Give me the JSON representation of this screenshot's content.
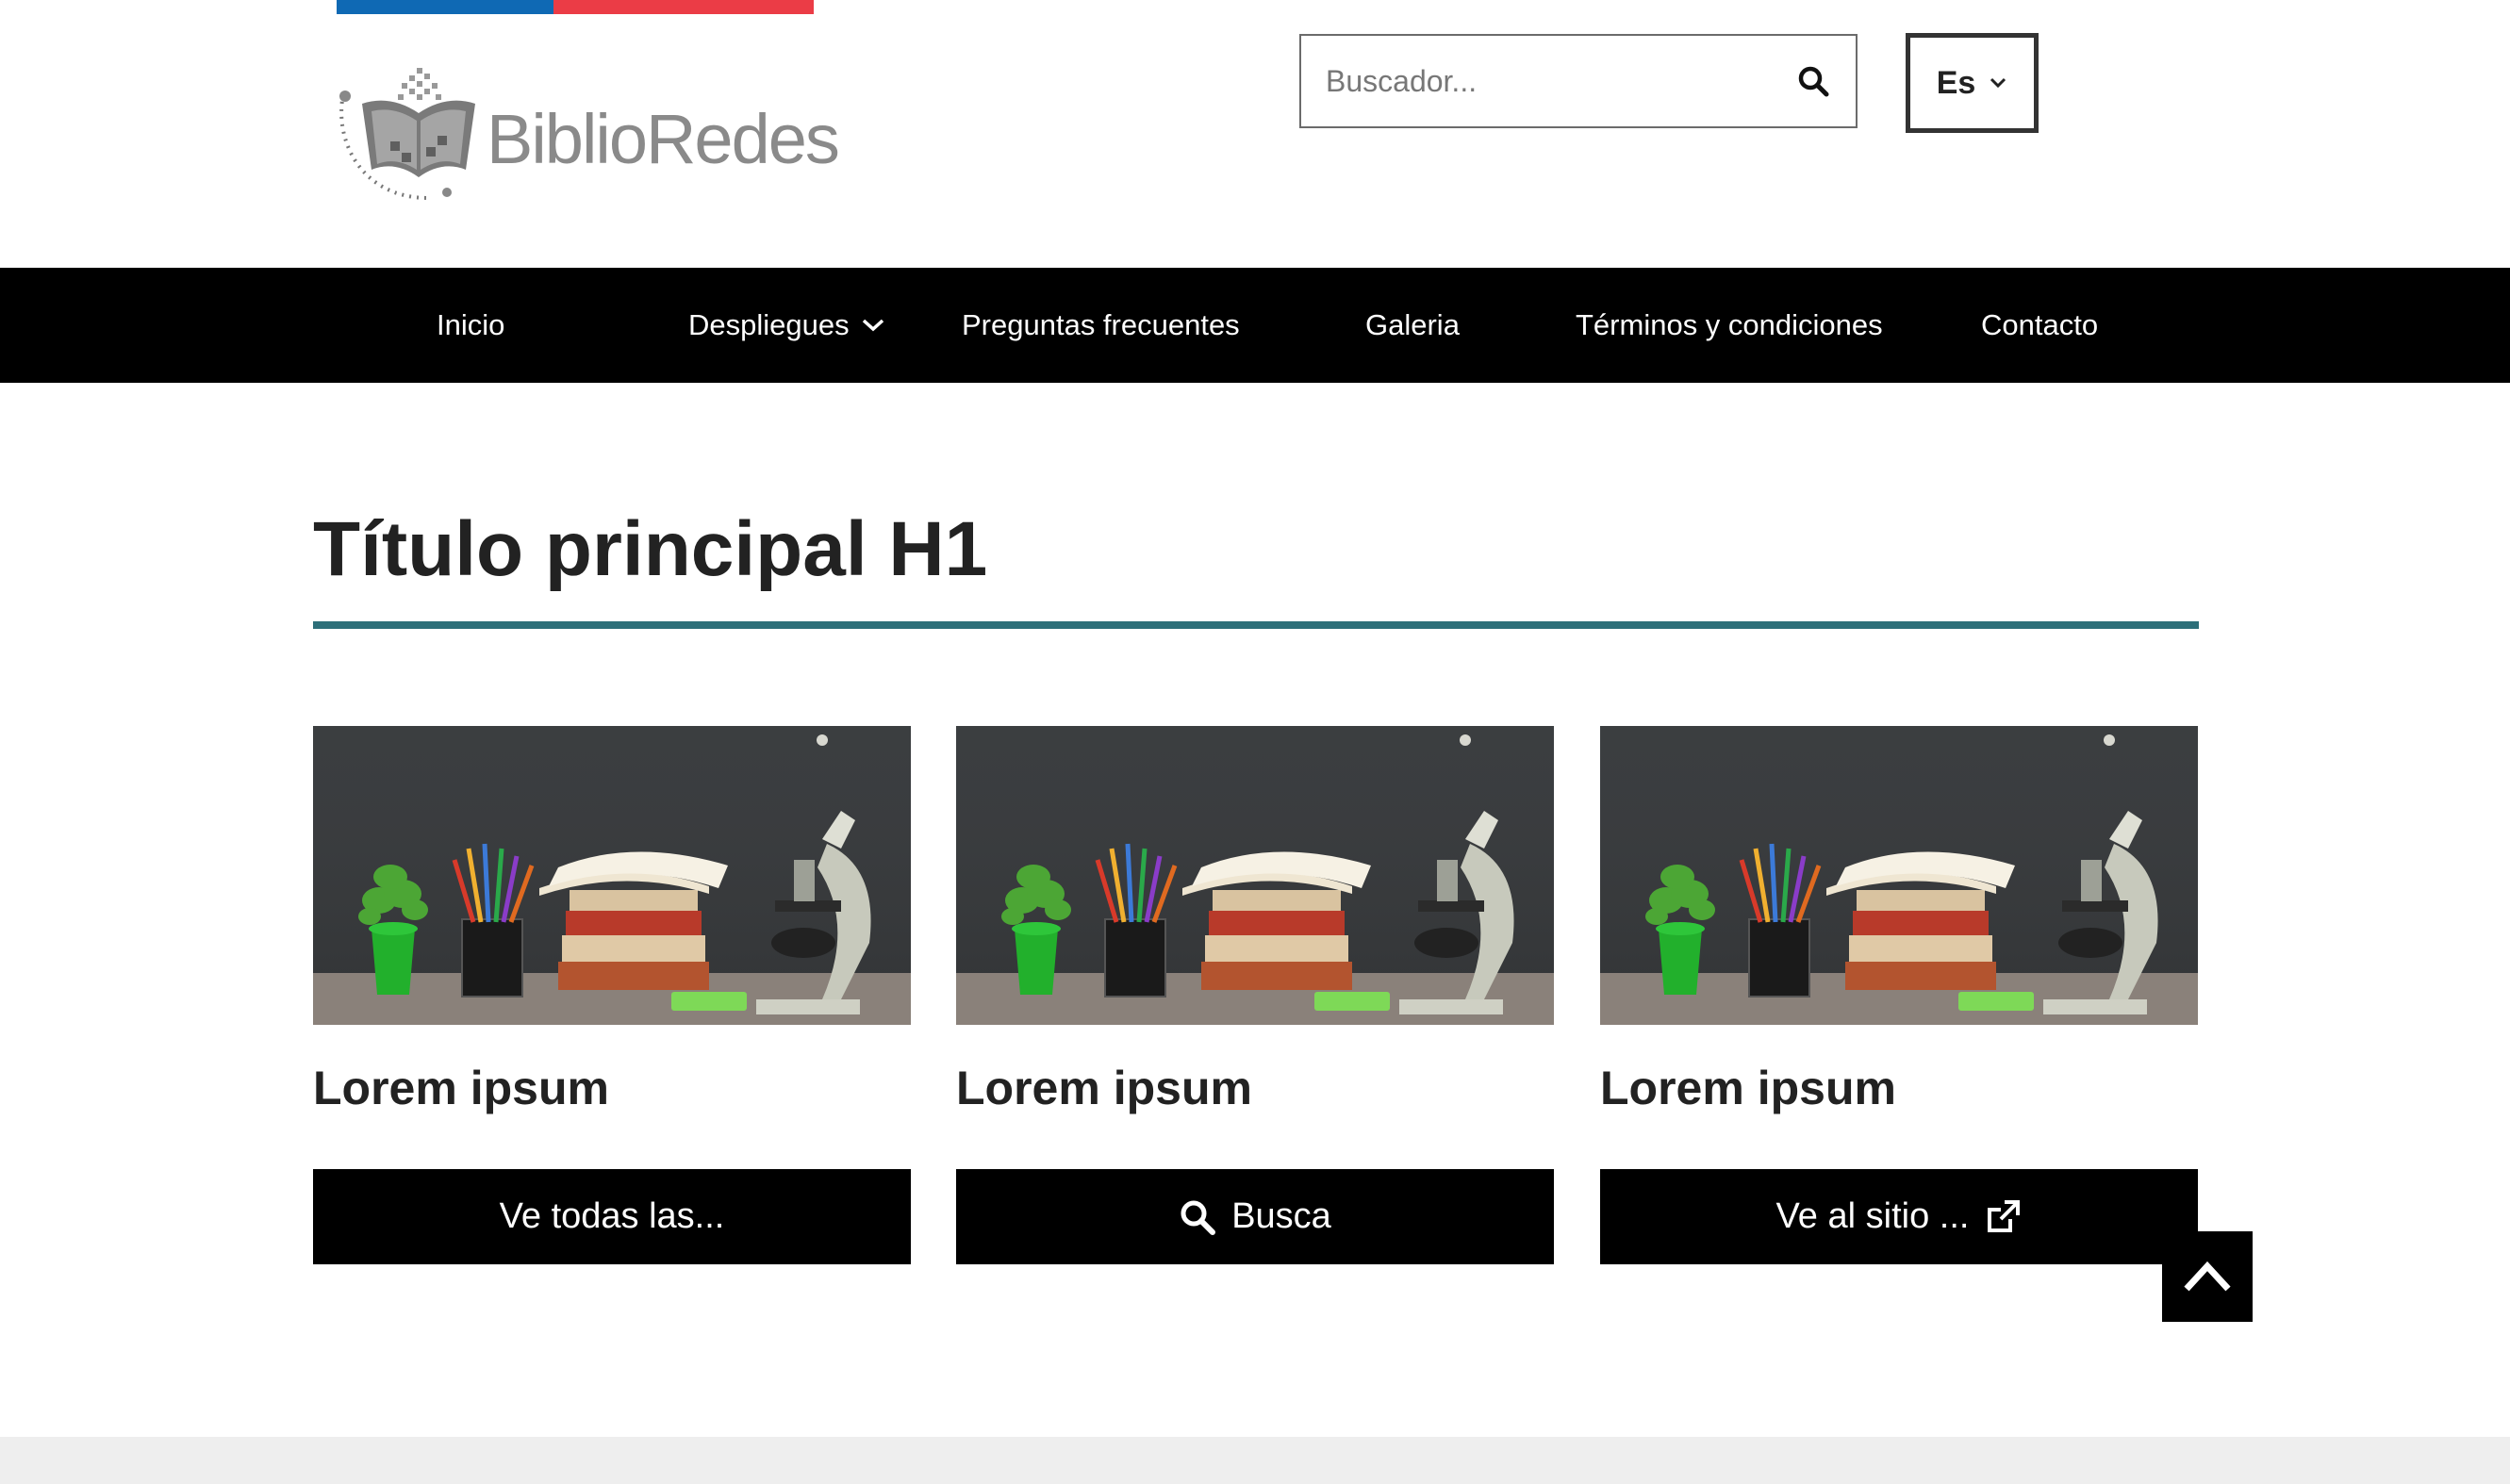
{
  "header": {
    "logo_text": "BiblioRedes",
    "search": {
      "placeholder": "Buscador..."
    },
    "language": {
      "selected": "Es"
    }
  },
  "nav": {
    "items": [
      {
        "label": "Inicio"
      },
      {
        "label": "Despliegues",
        "has_dropdown": true
      },
      {
        "label": "Preguntas frecuentes"
      },
      {
        "label": "Galeria"
      },
      {
        "label": "Términos y condiciones"
      },
      {
        "label": "Contacto"
      }
    ]
  },
  "main": {
    "title": "Título principal H1",
    "cards": [
      {
        "title": "Lorem ipsum",
        "button": "Ve todas las...",
        "button_icon": "none"
      },
      {
        "title": "Lorem ipsum",
        "button": "Busca",
        "button_icon": "search-icon"
      },
      {
        "title": "Lorem ipsum",
        "button": "Ve al sitio ...",
        "button_icon": "external-link-icon"
      }
    ]
  },
  "colors": {
    "flag_blue": "#0f69b4",
    "flag_red": "#eb3c46",
    "nav_bg": "#000000",
    "title_rule": "#2d6f79",
    "button_bg": "#000000",
    "footer_bg": "#eeeeee"
  }
}
